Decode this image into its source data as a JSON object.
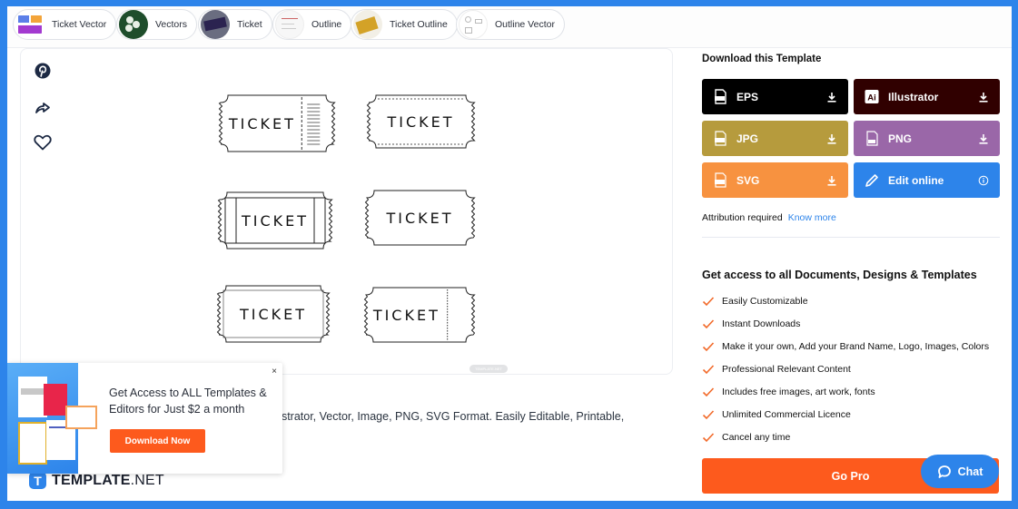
{
  "chips": [
    {
      "label": "Ticket Vector",
      "thumb": "ticket-vector-thumb"
    },
    {
      "label": "Vectors",
      "thumb": "vectors-thumb"
    },
    {
      "label": "Ticket",
      "thumb": "ticket-thumb"
    },
    {
      "label": "Outline",
      "thumb": "outline-thumb"
    },
    {
      "label": "Ticket Outline",
      "thumb": "ticket-outline-thumb"
    },
    {
      "label": "Outline Vector",
      "thumb": "outline-vector-thumb"
    }
  ],
  "preview": {
    "side_actions": [
      {
        "name": "pinterest",
        "icon": "pinterest-icon"
      },
      {
        "name": "share",
        "icon": "share-icon"
      },
      {
        "name": "favorite",
        "icon": "heart-icon"
      }
    ],
    "tickets": [
      "TICKET",
      "TICKET",
      "TICKET",
      "TICKET",
      "TICKET",
      "TICKET"
    ],
    "watermark": "TEMPLATE.NET"
  },
  "description": "ustrator, Vector, Image, PNG, SVG Format. Easily Editable, Printable,",
  "download": {
    "title": "Download this Template",
    "formats": [
      {
        "label": "EPS",
        "color": "#000000",
        "icon": "eps-file-icon",
        "action": "download-icon"
      },
      {
        "label": "Illustrator",
        "color": "#300000",
        "icon": "illustrator-icon",
        "action": "download-icon"
      },
      {
        "label": "JPG",
        "color": "#b69b3d",
        "icon": "jpg-file-icon",
        "action": "download-icon"
      },
      {
        "label": "PNG",
        "color": "#9a67a8",
        "icon": "png-file-icon",
        "action": "download-icon"
      },
      {
        "label": "SVG",
        "color": "#f79240",
        "icon": "svg-file-icon",
        "action": "download-icon"
      },
      {
        "label": "Edit online",
        "color": "#2d84ea",
        "icon": "pencil-icon",
        "action": "info-icon"
      }
    ],
    "attribution": "Attribution required",
    "know_more": "Know more"
  },
  "access": {
    "title": "Get access to all Documents, Designs & Templates",
    "features": [
      "Easily Customizable",
      "Instant Downloads",
      "Make it your own, Add your Brand Name, Logo, Images, Colors",
      "Professional Relevant Content",
      "Includes free images, art work, fonts",
      "Unlimited Commercial Licence",
      "Cancel any time"
    ],
    "go_pro": "Go Pro"
  },
  "chat": {
    "label": "Chat"
  },
  "popup": {
    "text": "Get Access to ALL Templates & Editors for Just $2 a month",
    "button": "Download Now",
    "close": "×"
  },
  "logo": {
    "mark": "T",
    "bold": "TEMPLATE",
    "light": ".NET"
  },
  "colors": {
    "accent": "#2d84ea",
    "cta": "#fd5a1d",
    "check": "#f26a2a"
  }
}
